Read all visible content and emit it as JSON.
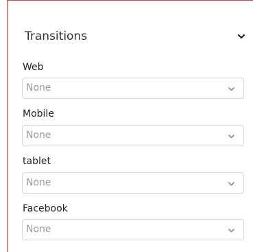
{
  "panel": {
    "title": "Transitions",
    "toggle_icon": "chevron-down-icon"
  },
  "fields": [
    {
      "label": "Web",
      "value": "None",
      "icon": "chevron-down-icon"
    },
    {
      "label": "Mobile",
      "value": "None",
      "icon": "chevron-down-icon"
    },
    {
      "label": "tablet",
      "value": "None",
      "icon": "chevron-down-icon"
    },
    {
      "label": "Facebook",
      "value": "None",
      "icon": "chevron-down-icon"
    }
  ],
  "colors": {
    "panel_border": "#d04a4a",
    "select_border": "#d6d6d6",
    "placeholder_text": "#9a9a9a"
  }
}
